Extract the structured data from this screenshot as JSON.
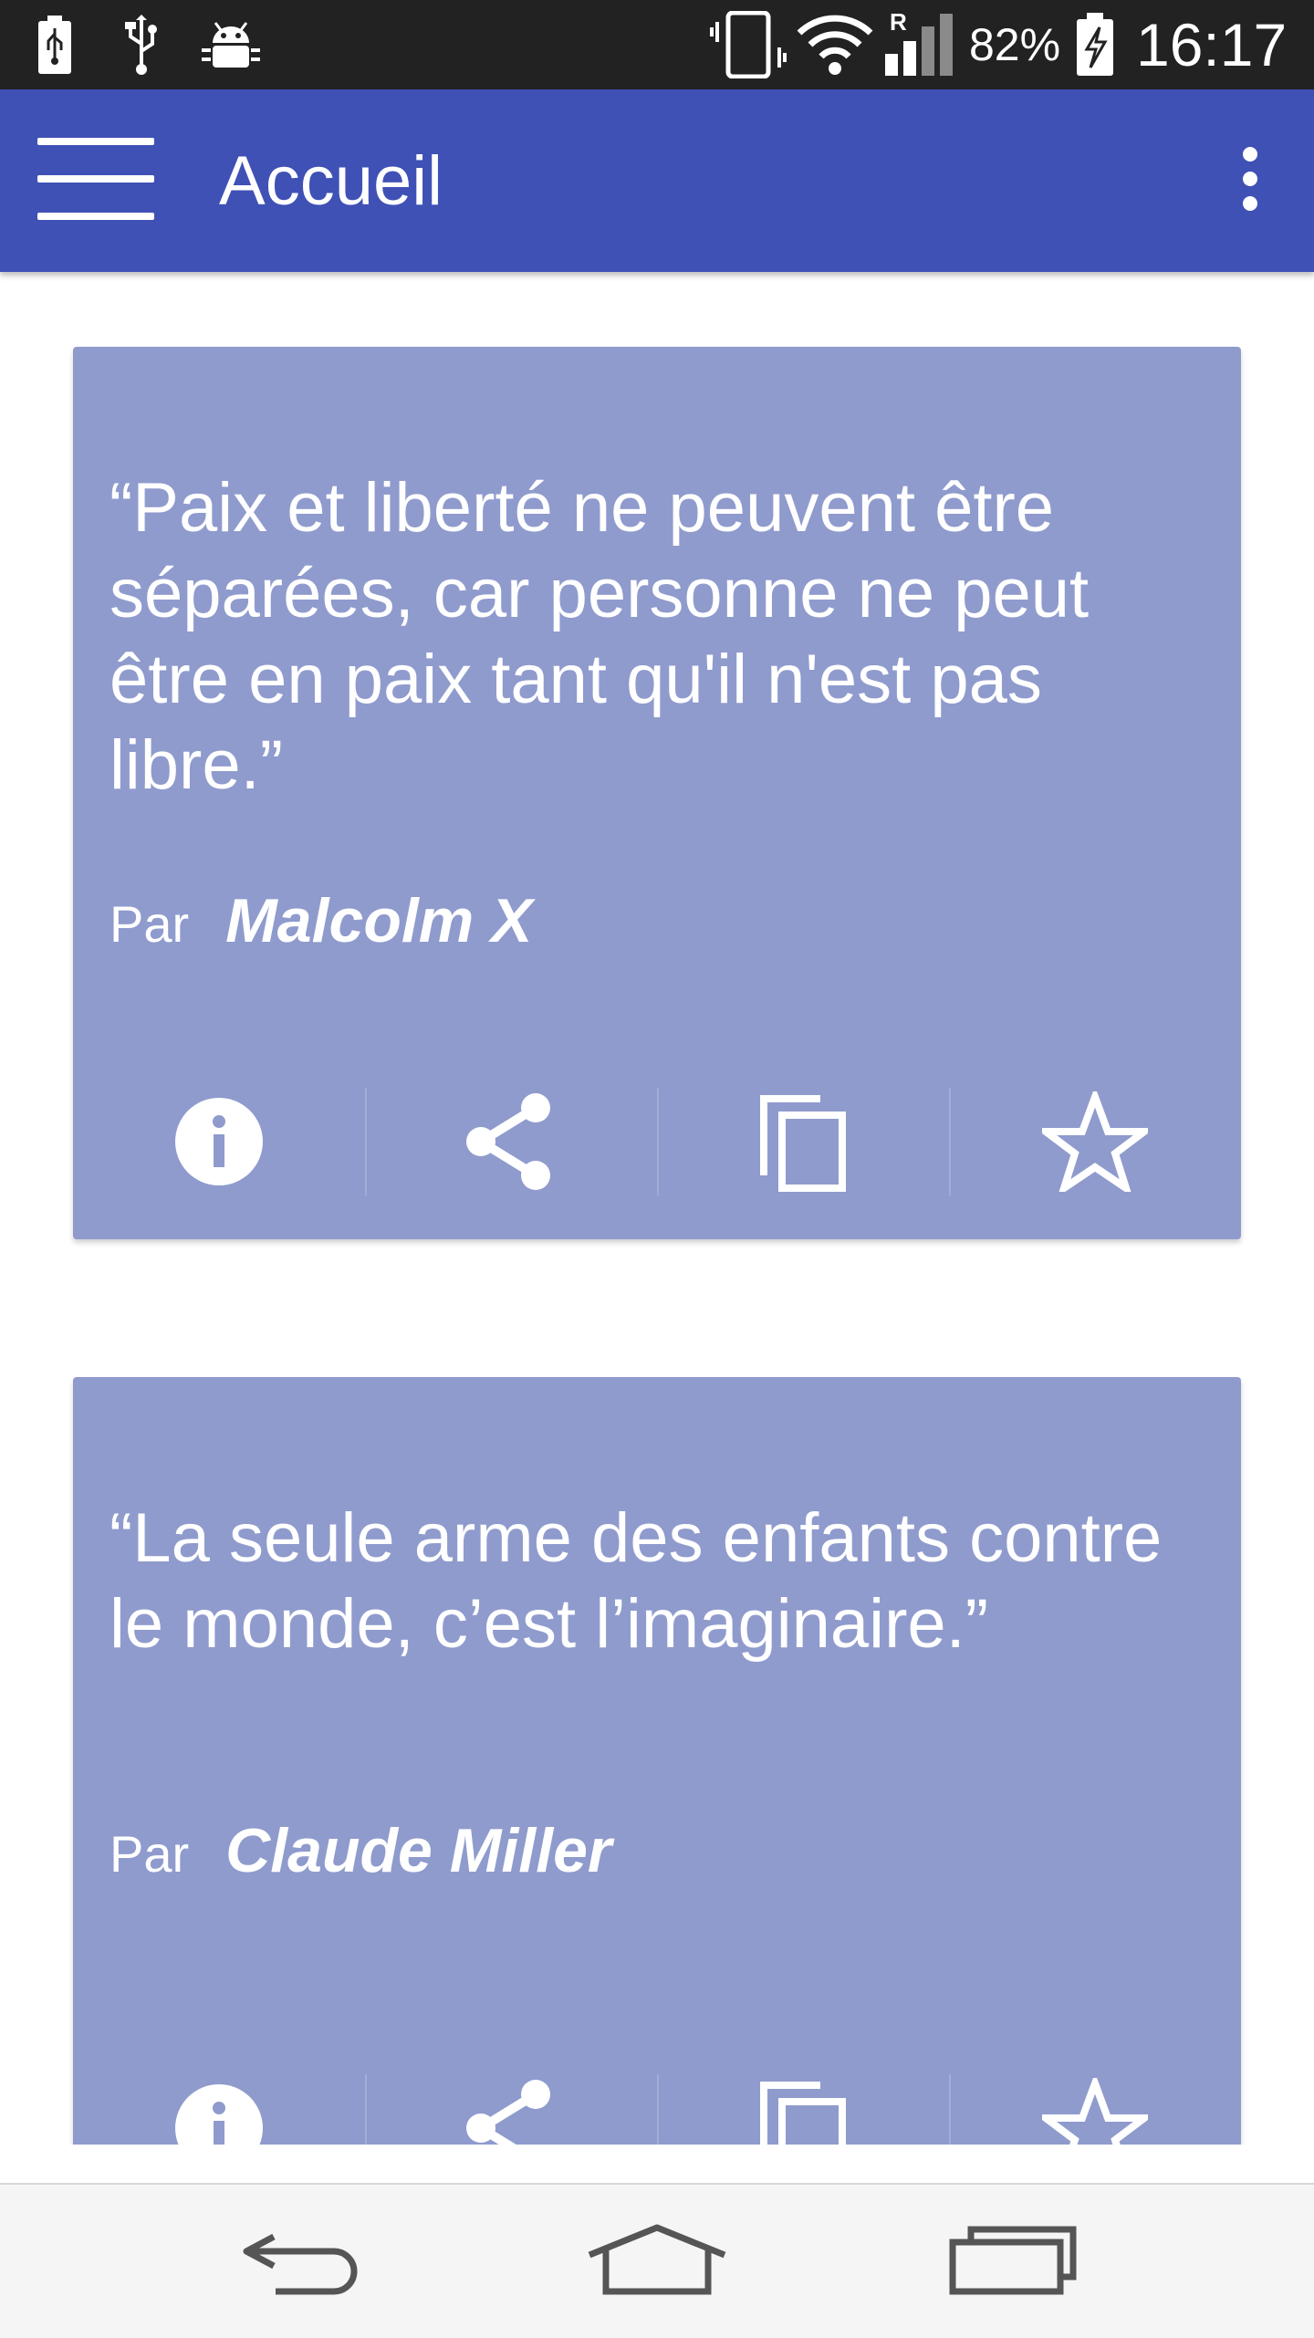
{
  "status_bar": {
    "battery_percent": "82%",
    "time": "16:17",
    "roaming_indicator": "R",
    "icons": [
      "battery-saver-icon",
      "usb-icon",
      "android-debug-icon",
      "vibrate-icon",
      "wifi-icon",
      "cell-signal-icon",
      "battery-charging-icon"
    ]
  },
  "app_bar": {
    "title": "Accueil",
    "color": "#3f51b5"
  },
  "quotes": [
    {
      "text": "“Paix et liberté ne peuvent être séparées, car personne ne peut être en paix tant qu'il n'est pas libre.”",
      "author_prefix": "Par",
      "author": "Malcolm X"
    },
    {
      "text": "“La seule arme des enfants contre le monde, c’est l’imaginaire.”",
      "author_prefix": "Par",
      "author": "Claude Miller"
    }
  ],
  "card_actions": [
    "info-icon",
    "share-icon",
    "copy-icon",
    "star-icon"
  ],
  "card_color": "#8f9bcd",
  "nav_bar": {
    "buttons": [
      "back-icon",
      "home-icon",
      "recent-apps-icon"
    ]
  }
}
